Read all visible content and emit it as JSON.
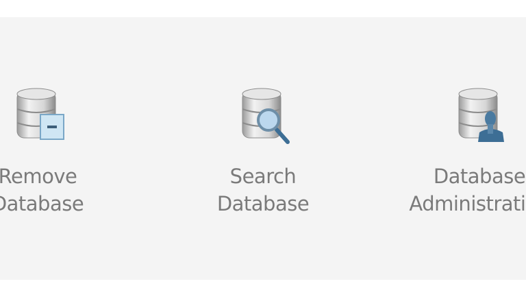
{
  "items": [
    {
      "line1": "Remove",
      "line2": "Database",
      "icon": "database-remove-icon"
    },
    {
      "line1": "Search",
      "line2": "Database",
      "icon": "database-search-icon"
    },
    {
      "line1": "Database",
      "line2": "Administration",
      "icon": "database-admin-icon"
    }
  ],
  "colors": {
    "panel": "#f4f4f4",
    "text": "#7a7a7a",
    "accent": "#3d6e95"
  }
}
